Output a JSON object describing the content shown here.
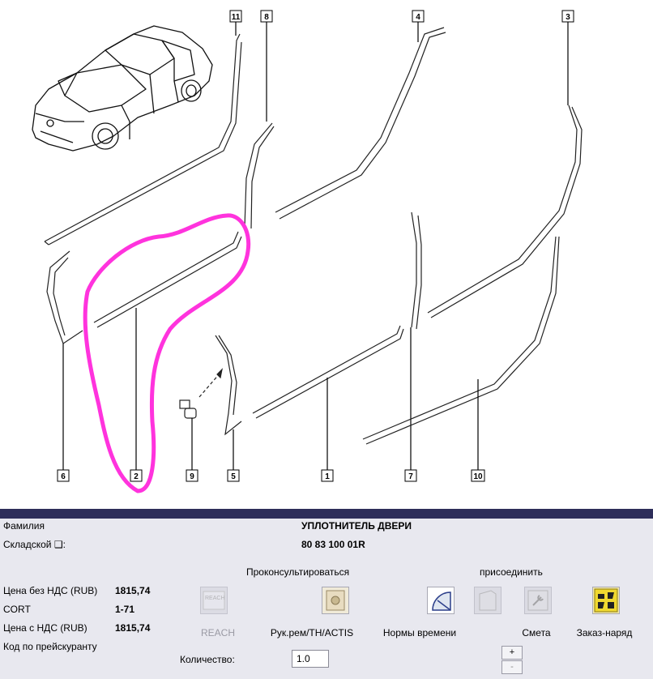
{
  "diagram": {
    "callouts": [
      "11",
      "8",
      "4",
      "3",
      "6",
      "2",
      "9",
      "5",
      "1",
      "7",
      "10"
    ]
  },
  "part": {
    "family_label": "Фамилия",
    "family_value": "УПЛОТНИТЕЛЬ ДВЕРИ",
    "stock_label": "Складской ❑:",
    "stock_value": "80 83 100 01R",
    "price_no_vat_label": "Цена без НДС (RUB)",
    "price_no_vat_value": "1815,74",
    "cort_label": "CORT",
    "cort_value": "1-71",
    "price_vat_label": "Цена с НДС (RUB)",
    "price_vat_value": "1815,74",
    "pricelist_code_label": "Код по прейскуранту"
  },
  "actions": {
    "consult_heading": "Проконсультироваться",
    "attach_heading": "присоединить",
    "reach_label": "REACH",
    "reach_icon_text": "REACH",
    "manual_label": "Рук.рем/TH/ACTIS",
    "time_norms_label": "Нормы времени",
    "estimate_label": "Смета",
    "work_order_label": "Заказ-наряд"
  },
  "quantity": {
    "label": "Количество:",
    "value": "1.0",
    "plus": "+",
    "minus": "-"
  },
  "colors": {
    "highlight": "#ff33dd",
    "header_bar": "#2e2e5a",
    "panel_bg": "#e8e8ef"
  }
}
